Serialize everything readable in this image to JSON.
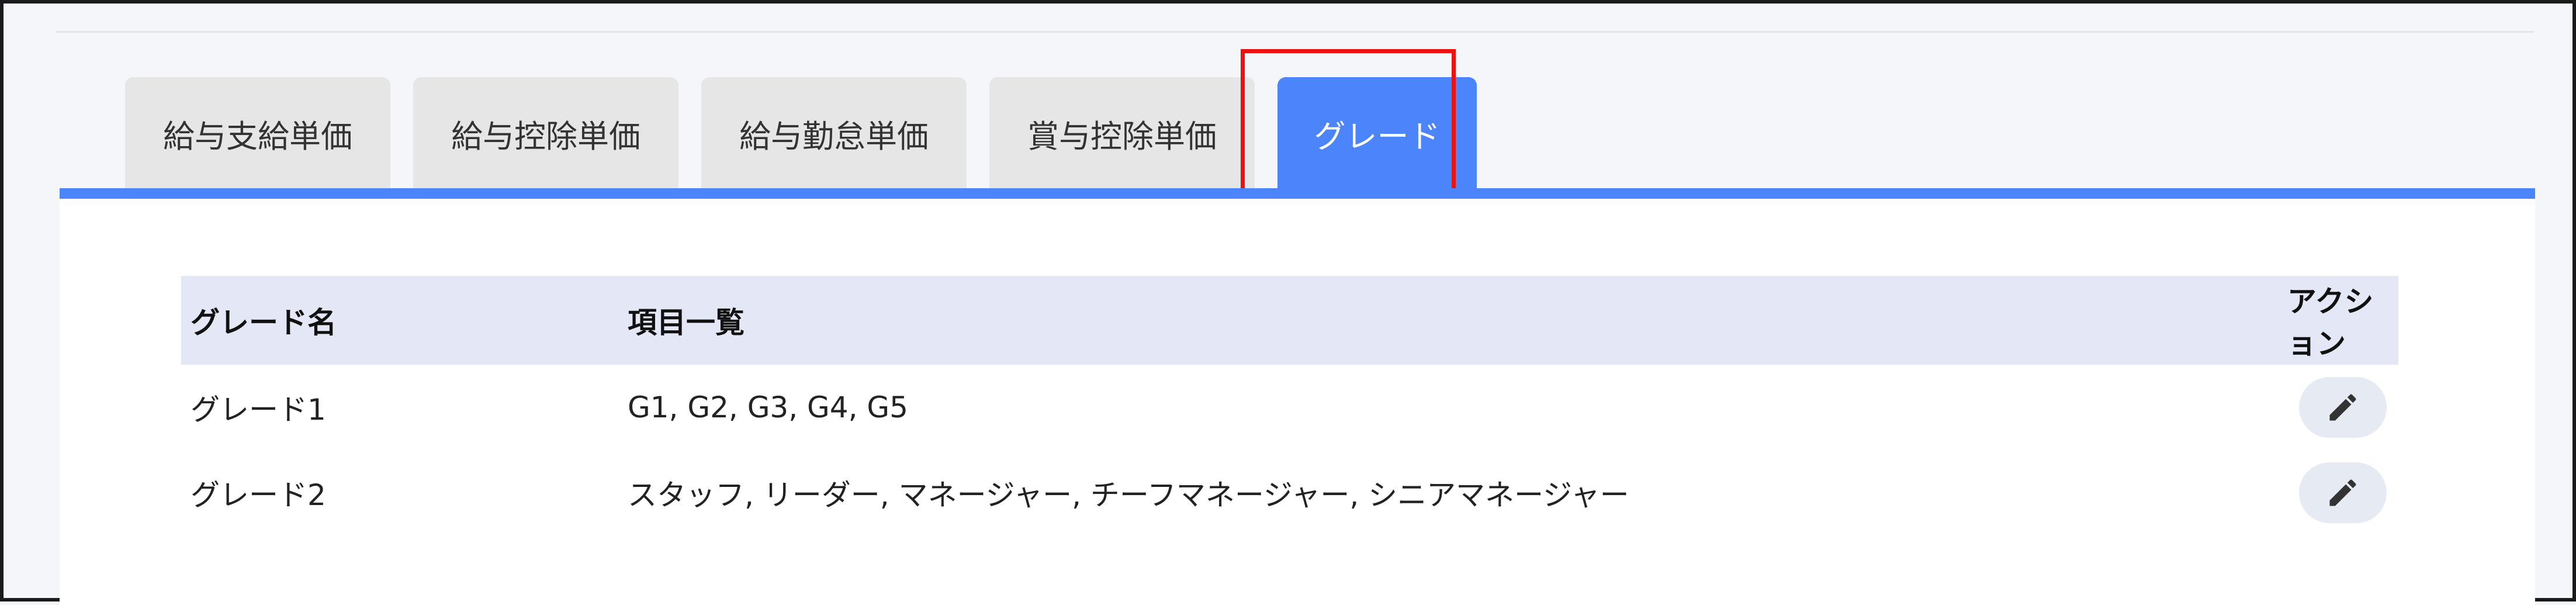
{
  "tabs": [
    {
      "label": "給与支給単価"
    },
    {
      "label": "給与控除単価"
    },
    {
      "label": "給与勤怠単価"
    },
    {
      "label": "賞与控除単価"
    },
    {
      "label": "グレード",
      "active": true
    }
  ],
  "table": {
    "headers": {
      "name": "グレード名",
      "items": "項目一覧",
      "action": "アクション"
    },
    "rows": [
      {
        "name": "グレード1",
        "items": "G1, G2, G3, G4, G5",
        "action_icon": "pencil-icon"
      },
      {
        "name": "グレード2",
        "items": "スタッフ, リーダー, マネージャー, チーフマネージャー, シニアマネージャー",
        "action_icon": "pencil-icon"
      }
    ]
  },
  "colors": {
    "accent": "#4b84fb",
    "highlight": "#ee1111",
    "header_bg": "#e4e8f6"
  }
}
